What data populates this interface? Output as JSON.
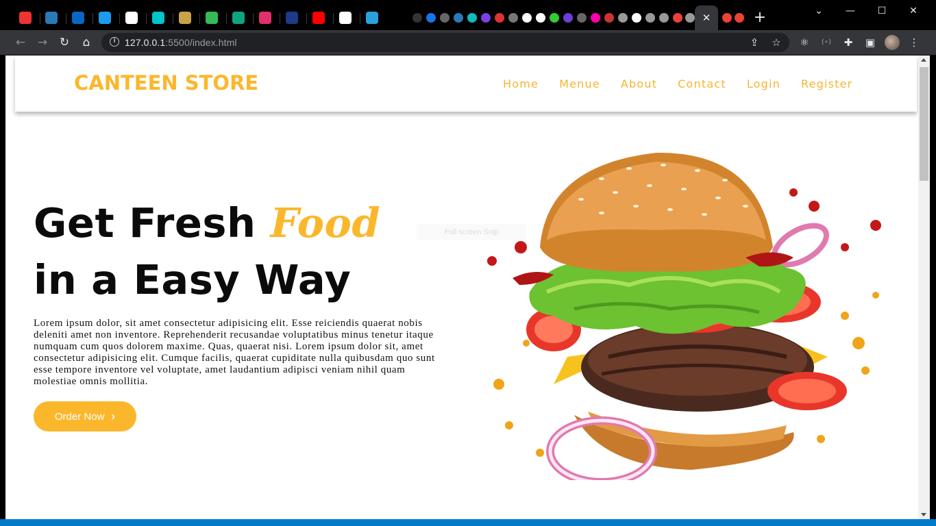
{
  "browser": {
    "url_host": "127.0.0.1",
    "url_rest": ":5500/index.html",
    "active_tab_close": "✕",
    "new_tab": "+",
    "tab_favicons": [
      {
        "name": "opera-icon",
        "color": "#e33"
      },
      {
        "name": "docs-icon",
        "color": "#2a7ab8"
      },
      {
        "name": "linkedin-icon",
        "color": "#0a66c2"
      },
      {
        "name": "twitter-icon",
        "color": "#1d9bf0"
      },
      {
        "name": "github-icon",
        "color": "#fff"
      },
      {
        "name": "canva-icon",
        "color": "#00c4cc"
      },
      {
        "name": "shield-icon",
        "color": "#c8a34a"
      },
      {
        "name": "circle-icon",
        "color": "#3b5"
      },
      {
        "name": "chatgpt-icon",
        "color": "#10a37f"
      },
      {
        "name": "instagram-icon",
        "color": "#e1306c"
      },
      {
        "name": "live-icon",
        "color": "#1e3a8a"
      },
      {
        "name": "youtube-icon",
        "color": "#f00"
      },
      {
        "name": "github-icon",
        "color": "#fff"
      },
      {
        "name": "telegram-icon",
        "color": "#2aa1da"
      }
    ]
  },
  "page": {
    "brand": "CANTEEN STORE",
    "nav": [
      "Home",
      "Menue",
      "About",
      "Contact",
      "Login",
      "Register"
    ],
    "hero_line1": "Get Fresh",
    "hero_accent": "Food",
    "hero_line2": "in a Easy Way",
    "hero_text": "Lorem ipsum dolor, sit amet consectetur adipisicing elit. Esse reiciendis quaerat nobis deleniti amet non inventore. Reprehenderit recusandae voluptatibus minus tenetur itaque numquam cum quos dolorem maxime. Quas, quaerat nisi. Lorem ipsum dolor sit, amet consectetur adipisicing elit. Cumque facilis, quaerat cupiditate nulla quibusdam quo sunt esse tempore inventore vel voluptate, amet laudantium adipisci veniam nihil quam molestiae omnis mollitia.",
    "order_button": "Order Now",
    "tooltip": "Full screen Snip"
  },
  "colors": {
    "accent": "#fbb72c",
    "text": "#0b0b0b"
  }
}
